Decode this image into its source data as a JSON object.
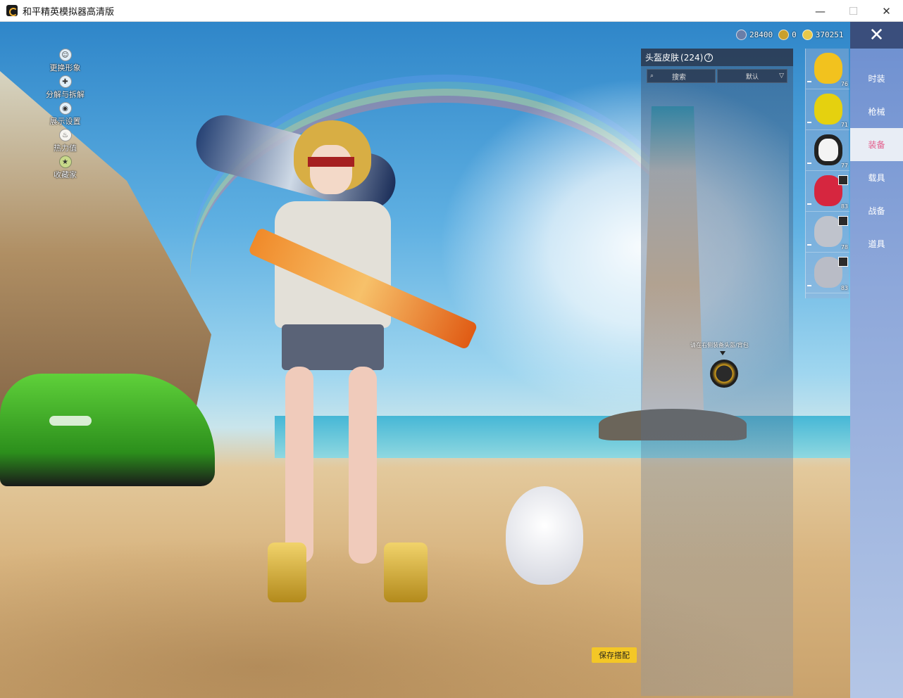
{
  "window": {
    "title": "和平精英模拟器高清版",
    "minimize_glyph": "—",
    "maximize_glyph": "☐",
    "close_glyph": "✕"
  },
  "left_menu": [
    {
      "label": "更换形象",
      "icon": "person-icon"
    },
    {
      "label": "分解与拆解",
      "icon": "split-icon"
    },
    {
      "label": "展示设置",
      "icon": "eye-icon"
    },
    {
      "label": "热力值",
      "icon": "flame-icon"
    },
    {
      "label": "收藏家",
      "icon": "badge-icon"
    }
  ],
  "currency": [
    {
      "value": "28400",
      "icon": "coupon-icon",
      "color": "#6a7ea8"
    },
    {
      "value": "0",
      "icon": "token-icon",
      "color": "#c9a02c"
    },
    {
      "value": "370251",
      "icon": "coin-icon",
      "color": "#e8c84a"
    }
  ],
  "panel": {
    "title": "头盔皮肤",
    "count": "(224)",
    "search_label": "搜索",
    "sort_label": "默认"
  },
  "hint_text": "请在右侧装备头盔/背包",
  "items": [
    {
      "num": "76",
      "color": "#f2c21e",
      "badge": false
    },
    {
      "num": "71",
      "color": "#e5d10f",
      "badge": false
    },
    {
      "num": "77",
      "color": "#f4f4f4",
      "badge": false
    },
    {
      "num": "83",
      "color": "#d6263f",
      "badge": true
    },
    {
      "num": "78",
      "color": "#bfc3cc",
      "badge": true
    },
    {
      "num": "83",
      "color": "#b9bcc6",
      "badge": true
    }
  ],
  "nav": {
    "close_glyph": "✕",
    "items": [
      "时装",
      "枪械",
      "装备",
      "载具",
      "战备",
      "道具"
    ],
    "active_index": 2
  },
  "save_button": "保存搭配"
}
